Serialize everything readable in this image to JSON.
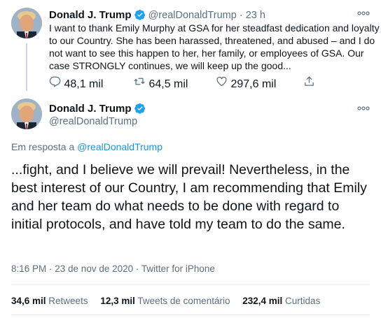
{
  "tweet1": {
    "name": "Donald J. Trump",
    "handle": "@realDonaldTrump",
    "separator": "·",
    "time": "23 h",
    "text": "I want to thank Emily Murphy at GSA for her steadfast dedication and loyalty to our Country. She has been harassed, threatened, and abused – and I do not want to see this happen to her, her family, or employees of GSA. Our case STRONGLY continues, we will keep up the good...",
    "replies": "48,1 mil",
    "retweets": "64,5 mil",
    "likes": "297,6 mil"
  },
  "tweet2": {
    "name": "Donald J. Trump",
    "handle": "@realDonaldTrump",
    "reply_prefix": "Em resposta a",
    "reply_handle": "@realDonaldTrump",
    "text": "...fight, and I believe we will prevail! Nevertheless, in the best interest of our Country, I am recommending that Emily and her team do what needs to be done with regard to initial protocols, and have told my team to do the same.",
    "timestamp": "8:16 PM · 23 de nov de 2020 · Twitter for iPhone"
  },
  "stats": {
    "retweets_count": "34,6 mil",
    "retweets_label": "Retweets",
    "comments_count": "12,3 mil",
    "comments_label": "Tweets de comentário",
    "likes_count": "232,4 mil",
    "likes_label": "Curtidas"
  },
  "colors": {
    "verified": "#1da1f2",
    "link": "#1b95e0",
    "secondary_text": "#5b7083",
    "divider": "#e6ecf0"
  },
  "icons": [
    "verified-badge-icon",
    "more-options-icon",
    "reply-icon",
    "retweet-icon",
    "like-icon",
    "share-icon"
  ]
}
